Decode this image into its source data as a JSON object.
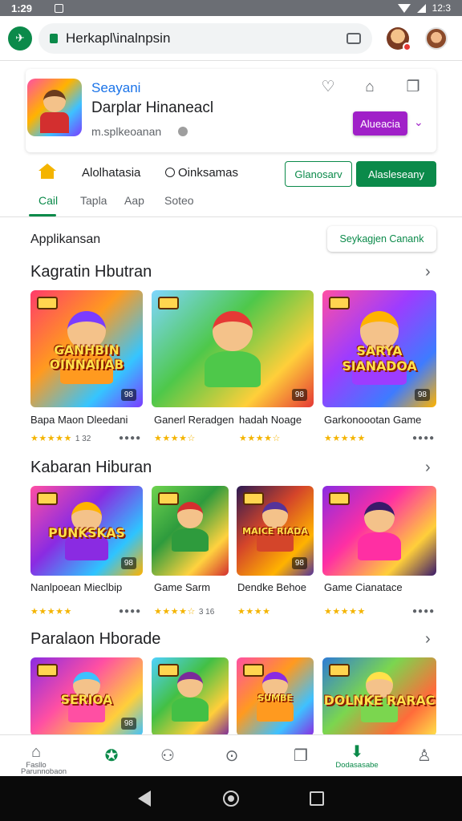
{
  "status_bar": {
    "time": "1:29",
    "battery": "12:3"
  },
  "browser": {
    "url": "Herkapl\\inalnpsin"
  },
  "app_card": {
    "name": "Seayani",
    "subtitle": "Darplar Hinaneacl",
    "meta": "m.splkeoanan",
    "install_label": "Alueacia"
  },
  "filters": {
    "item1": "Alolhatasia",
    "item2": "Oinksamas",
    "outline_button": "Glanosarv",
    "fill_button": "Alasleseany"
  },
  "tabs": [
    "Cail",
    "Tapla",
    "Aap",
    "Soteo"
  ],
  "applikasi_label": "Applikansan",
  "pill_button": "Seykagjen Canank",
  "sections": [
    {
      "title": "Kagratin Hbutran",
      "games": [
        {
          "label": "Bapa Maon Dleedani",
          "rating": "★★★★★",
          "count": "1 32",
          "art": "GANHBIN OINNAIIAB",
          "badge": "98",
          "colors": [
            "#ff3b6b",
            "#ff9a1f",
            "#35c5ff",
            "#7b3cff"
          ]
        },
        {
          "label": "Ganerl Reradgen",
          "rating": "★★★★☆",
          "count": "",
          "art": "",
          "badge": "98",
          "colors": [
            "#7fd6ff",
            "#4ec84a",
            "#ffcf3a",
            "#e53935"
          ]
        },
        {
          "label": "hadah Noage",
          "rating": "★★★★☆",
          "count": "",
          "art": "",
          "badge": "",
          "colors": []
        },
        {
          "label": "Garkonoootan Game",
          "rating": "★★★★★",
          "count": "",
          "art": "SARYA SIANADOA",
          "badge": "98",
          "colors": [
            "#ff4fa3",
            "#9d3cff",
            "#3e7bff",
            "#ffb300"
          ]
        }
      ]
    },
    {
      "title": "Kabaran Hiburan",
      "games": [
        {
          "label": "Nanlpoean Mieclbip",
          "rating": "★★★★★",
          "count": "",
          "art": "PUNKSKAS",
          "badge": "98",
          "colors": [
            "#ff4fa3",
            "#8a2be2",
            "#2ec4ff",
            "#ffb300"
          ]
        },
        {
          "label": "Game Sarm",
          "rating": "★★★★☆",
          "count": "3 16",
          "art": "",
          "badge": "",
          "colors": [
            "#6ed34f",
            "#2e9b3d",
            "#ffd23f",
            "#d32f2f"
          ]
        },
        {
          "label": "Dendke Behoe",
          "rating": "★★★★",
          "count": "",
          "art": "MAICE RIADA",
          "badge": "98",
          "colors": [
            "#2b1a52",
            "#d4452a",
            "#ffb300",
            "#553399"
          ]
        },
        {
          "label": "Game Cianatace",
          "rating": "★★★★★",
          "count": "",
          "art": "",
          "badge": "",
          "colors": [
            "#8a2be2",
            "#ff2fa3",
            "#ffcf3a",
            "#3a1a6a"
          ]
        }
      ]
    },
    {
      "title": "Paralaon Hborade",
      "games": [
        {
          "label": "",
          "rating": "",
          "count": "",
          "art": "SERIOA",
          "badge": "98",
          "colors": [
            "#8a2be2",
            "#ff4fa3",
            "#ffcf3a",
            "#3ec1ff"
          ]
        },
        {
          "label": "",
          "rating": "",
          "count": "",
          "art": "",
          "badge": "",
          "colors": [
            "#4fd1ff",
            "#43c045",
            "#ffcf3a",
            "#7b2a9a"
          ]
        },
        {
          "label": "",
          "rating": "",
          "count": "",
          "art": "SUMBE",
          "badge": "",
          "colors": [
            "#ff4fa3",
            "#ff9a1f",
            "#3ec1ff",
            "#8a2be2"
          ]
        },
        {
          "label": "",
          "rating": "",
          "count": "",
          "art": "DOLNKE RARAC",
          "badge": "",
          "colors": [
            "#2e7bd6",
            "#7bd64f",
            "#ff6b3a",
            "#ffe14a"
          ]
        }
      ]
    }
  ],
  "bottom_nav": [
    {
      "label": "Fasllo\nPanaiabs",
      "icon": "home-icon",
      "glyph": "⌂"
    },
    {
      "label": "",
      "icon": "gamepad-icon",
      "glyph": "✪"
    },
    {
      "label": "",
      "icon": "person-icon",
      "glyph": "⚇"
    },
    {
      "label": "",
      "icon": "compass-icon",
      "glyph": "⊙"
    },
    {
      "label": "",
      "icon": "notification-icon",
      "glyph": "❐"
    },
    {
      "label": "Dodasasabe",
      "icon": "download-icon",
      "glyph": "⬇"
    },
    {
      "label": "",
      "icon": "account-icon",
      "glyph": "♙"
    }
  ],
  "footer_label": "Parunnobaon",
  "colors": {
    "accent": "#0b8a4a",
    "install": "#a020c8",
    "link": "#1a73e8",
    "star": "#f4b400"
  }
}
